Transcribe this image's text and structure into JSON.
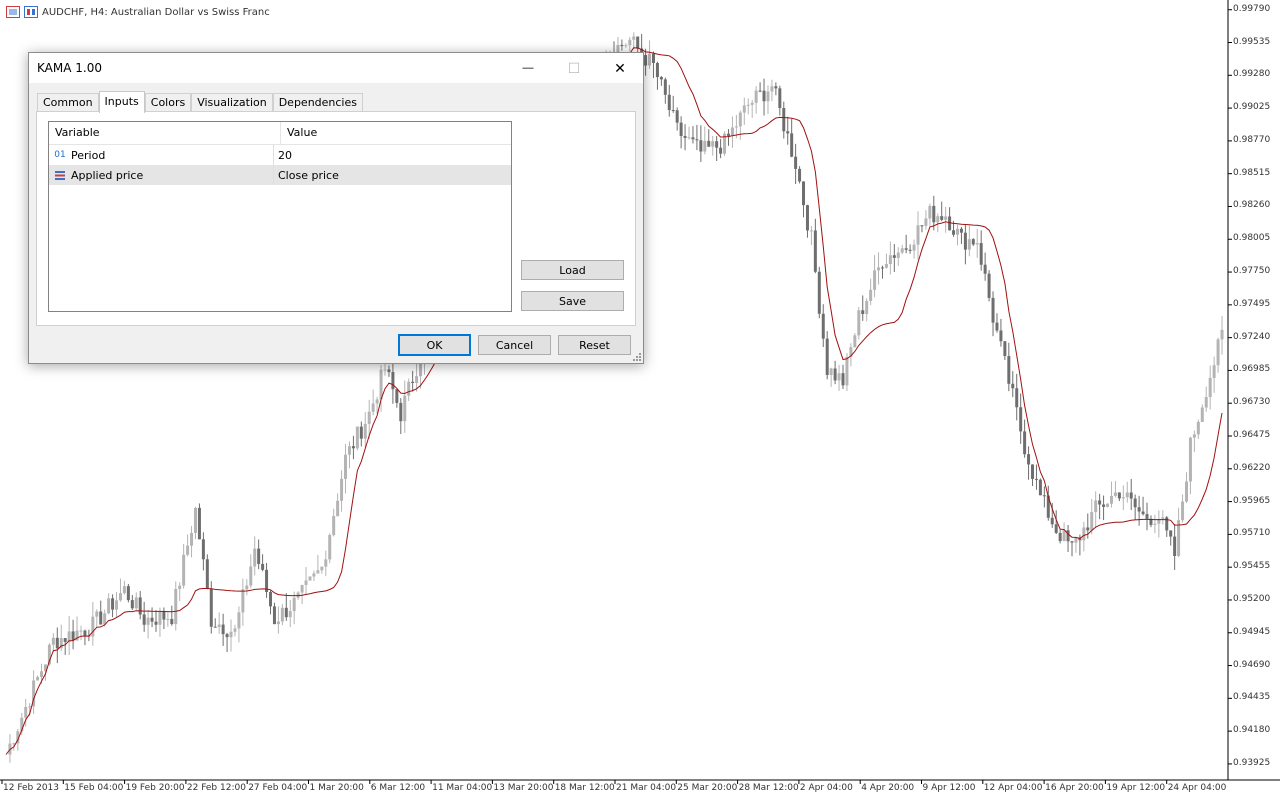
{
  "chart": {
    "header_title": "AUDCHF, H4:  Australian Dollar vs Swiss  Franc",
    "y_ticks": [
      "0.99790",
      "0.99535",
      "0.99280",
      "0.99025",
      "0.98770",
      "0.98515",
      "0.98260",
      "0.98005",
      "0.97750",
      "0.97495",
      "0.97240",
      "0.96985",
      "0.96730",
      "0.96475",
      "0.96220",
      "0.95965",
      "0.95710",
      "0.95455",
      "0.95200",
      "0.94945",
      "0.94690",
      "0.94435",
      "0.94180",
      "0.93925"
    ],
    "x_ticks": [
      "12 Feb 2013",
      "15 Feb 04:00",
      "19 Feb 20:00",
      "22 Feb 12:00",
      "27 Feb 04:00",
      "1 Mar 20:00",
      "6 Mar 12:00",
      "11 Mar 04:00",
      "13 Mar 20:00",
      "18 Mar 12:00",
      "21 Mar 04:00",
      "25 Mar 20:00",
      "28 Mar 12:00",
      "2 Apr 04:00",
      "4 Apr 20:00",
      "9 Apr 12:00",
      "12 Apr 04:00",
      "16 Apr 20:00",
      "19 Apr 12:00",
      "24 Apr 04:00"
    ],
    "colors": {
      "bull": "#b4b4b4",
      "bear": "#6e6e6e",
      "indicator": "#a01010",
      "grid": "#c8c8c8"
    }
  },
  "chart_data": {
    "type": "candlestick",
    "ylim": [
      0.938,
      0.9985
    ],
    "kama_period": 20,
    "price_path_anchors": [
      [
        0,
        0.94
      ],
      [
        12,
        0.9488
      ],
      [
        22,
        0.95
      ],
      [
        30,
        0.9528
      ],
      [
        35,
        0.9505
      ],
      [
        42,
        0.9508
      ],
      [
        48,
        0.959
      ],
      [
        52,
        0.9505
      ],
      [
        58,
        0.9495
      ],
      [
        63,
        0.956
      ],
      [
        68,
        0.9505
      ],
      [
        74,
        0.952
      ],
      [
        80,
        0.9545
      ],
      [
        86,
        0.963
      ],
      [
        92,
        0.9665
      ],
      [
        96,
        0.97
      ],
      [
        100,
        0.9665
      ],
      [
        106,
        0.972
      ],
      [
        112,
        0.976
      ],
      [
        118,
        0.98
      ],
      [
        124,
        0.984
      ],
      [
        130,
        0.988
      ],
      [
        134,
        0.9815
      ],
      [
        140,
        0.984
      ],
      [
        146,
        0.9905
      ],
      [
        152,
        0.9945
      ],
      [
        158,
        0.9955
      ],
      [
        164,
        0.9935
      ],
      [
        170,
        0.9885
      ],
      [
        176,
        0.9868
      ],
      [
        182,
        0.9875
      ],
      [
        188,
        0.9905
      ],
      [
        194,
        0.992
      ],
      [
        200,
        0.986
      ],
      [
        204,
        0.98
      ],
      [
        208,
        0.97
      ],
      [
        212,
        0.969
      ],
      [
        216,
        0.974
      ],
      [
        222,
        0.9785
      ],
      [
        228,
        0.9795
      ],
      [
        234,
        0.982
      ],
      [
        238,
        0.982
      ],
      [
        242,
        0.98
      ],
      [
        246,
        0.98
      ],
      [
        250,
        0.974
      ],
      [
        254,
        0.969
      ],
      [
        258,
        0.964
      ],
      [
        262,
        0.96
      ],
      [
        266,
        0.9575
      ],
      [
        270,
        0.956
      ],
      [
        276,
        0.959
      ],
      [
        282,
        0.9605
      ],
      [
        288,
        0.9585
      ],
      [
        292,
        0.9585
      ],
      [
        296,
        0.9555
      ],
      [
        300,
        0.964
      ],
      [
        304,
        0.9685
      ],
      [
        308,
        0.9725
      ]
    ]
  },
  "dialog": {
    "title": "KAMA 1.00",
    "tabs": [
      "Common",
      "Inputs",
      "Colors",
      "Visualization",
      "Dependencies"
    ],
    "active_tab": "Inputs",
    "columns": [
      "Variable",
      "Value"
    ],
    "rows": [
      {
        "icon": "integer-param-icon",
        "icon_text": "01",
        "variable": "Period",
        "value": "20"
      },
      {
        "icon": "enum-param-icon",
        "icon_text": "",
        "variable": "Applied price",
        "value": "Close price"
      }
    ],
    "buttons": {
      "load": "Load",
      "save": "Save",
      "ok": "OK",
      "cancel": "Cancel",
      "reset": "Reset"
    },
    "window_controls": {
      "minimize": "—",
      "maximize": "☐",
      "close": "✕"
    }
  }
}
